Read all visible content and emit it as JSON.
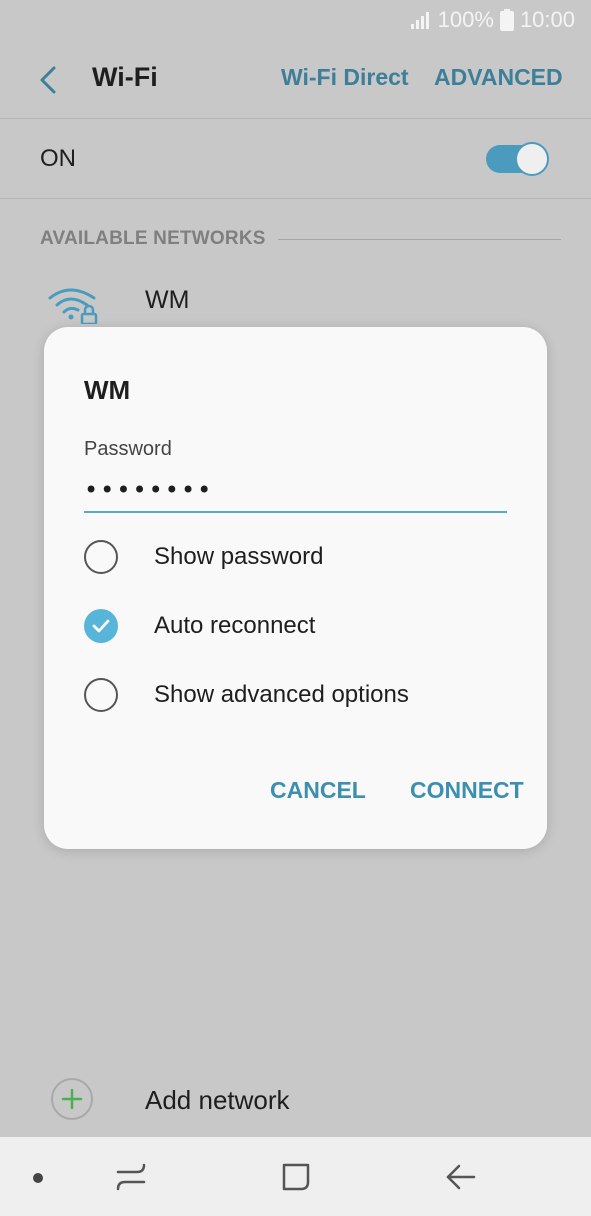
{
  "status": {
    "battery": "100%",
    "time": "10:00"
  },
  "app_bar": {
    "title": "Wi-Fi",
    "wifi_direct": "Wi-Fi Direct",
    "advanced": "ADVANCED"
  },
  "toggle_row": {
    "label": "ON",
    "enabled": true
  },
  "available": {
    "header": "AVAILABLE NETWORKS",
    "networks": [
      {
        "name": "WM",
        "secured": true
      }
    ]
  },
  "add_network": {
    "label": "Add network"
  },
  "dialog": {
    "title": "WM",
    "password_label": "Password",
    "password_value": "••••••••",
    "options": [
      {
        "label": "Show password",
        "checked": false
      },
      {
        "label": "Auto reconnect",
        "checked": true
      },
      {
        "label": "Show advanced options",
        "checked": false
      }
    ],
    "cancel": "CANCEL",
    "connect": "CONNECT"
  },
  "colors": {
    "accent": "#3d7f99",
    "toggle": "#4a9bbe",
    "checked": "#56b5d8",
    "scrim": "#c8c8c8",
    "add_icon": "#4caf50"
  },
  "icons": {
    "back": "chevron-left-icon",
    "wifi": "wifi-lock-icon",
    "add": "plus-icon",
    "nav_recents": "recents-icon",
    "nav_home": "home-icon",
    "nav_back": "back-arrow-icon"
  }
}
